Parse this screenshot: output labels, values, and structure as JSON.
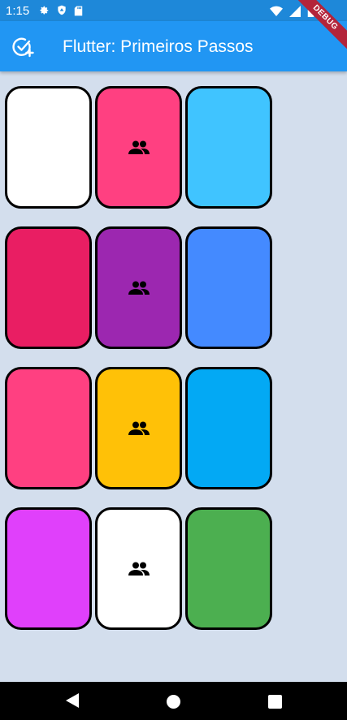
{
  "status_bar": {
    "time": "1:15",
    "icons_left": [
      "gear-icon",
      "shield-icon",
      "sd-card-icon"
    ],
    "icons_right": [
      "wifi-icon",
      "signal-icon",
      "battery-icon"
    ],
    "debug_banner": "DEBUG"
  },
  "app_bar": {
    "title": "Flutter: Primeiros Passos",
    "leading_icon": "add-task-icon",
    "color": "#2196f3"
  },
  "colors": {
    "background": "#d3deed",
    "status_bar": "#1e88d9"
  },
  "tiles": [
    {
      "color": "#ffffff",
      "icon": false
    },
    {
      "color": "#ff4081",
      "icon": true
    },
    {
      "color": "#40c4ff",
      "icon": false
    },
    {
      "color": "#e91e63",
      "icon": false
    },
    {
      "color": "#9c27b0",
      "icon": true
    },
    {
      "color": "#448aff",
      "icon": false
    },
    {
      "color": "#ff4081",
      "icon": false
    },
    {
      "color": "#ffc107",
      "icon": true
    },
    {
      "color": "#03a9f4",
      "icon": false
    },
    {
      "color": "#e040fb",
      "icon": false
    },
    {
      "color": "#ffffff",
      "icon": true
    },
    {
      "color": "#4caf50",
      "icon": false
    }
  ],
  "tile_icon": "people-icon",
  "nav_bar": {
    "buttons": [
      "back-icon",
      "home-icon",
      "recents-icon"
    ]
  }
}
